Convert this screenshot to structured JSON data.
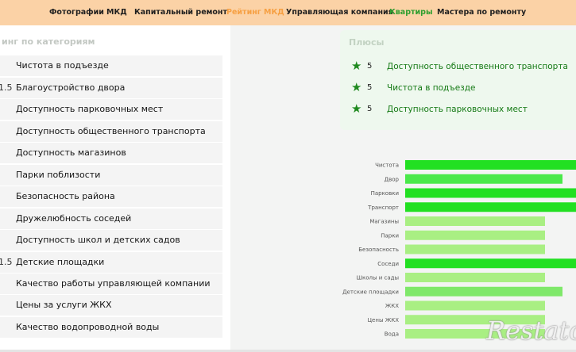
{
  "nav": {
    "items": [
      {
        "label": "Фотографии"
      },
      {
        "label": "МКД"
      },
      {
        "label": "Капитальный ремонт"
      },
      {
        "label": "Рейтинг МКД"
      },
      {
        "label": "Управляющая компания"
      },
      {
        "label": "Квартиры"
      },
      {
        "label": "Мастера по ремонту"
      }
    ],
    "active_item": "Рейтинг МКД",
    "highlight_item": "Квартиры"
  },
  "rating": {
    "title": "инг по категориям",
    "rows": [
      {
        "score": "",
        "label": "Чистота в подъезде"
      },
      {
        "score": "1.5",
        "label": "Благоустройство двора"
      },
      {
        "score": "",
        "label": "Доступность парковочных мест"
      },
      {
        "score": "",
        "label": "Доступность общественного транспорта"
      },
      {
        "score": "",
        "label": "Доступность магазинов"
      },
      {
        "score": "",
        "label": "Парки поблизости"
      },
      {
        "score": "",
        "label": "Безопасность района"
      },
      {
        "score": "",
        "label": "Дружелюбность соседей"
      },
      {
        "score": "",
        "label": "Доступность школ и детских садов"
      },
      {
        "score": "1.5",
        "label": "Детские площадки"
      },
      {
        "score": "",
        "label": "Качество работы управляющей компании"
      },
      {
        "score": "",
        "label": "Цены за услуги ЖКХ"
      },
      {
        "score": "",
        "label": "Качество водопроводной воды"
      }
    ]
  },
  "plus": {
    "title": "Плюсы",
    "items": [
      {
        "score": "5",
        "label": "Доступность общественного транспорта"
      },
      {
        "score": "5",
        "label": "Чистота в подъезде"
      },
      {
        "score": "5",
        "label": "Доступность парковочных мест"
      }
    ]
  },
  "chart_data": {
    "type": "bar",
    "orientation": "horizontal",
    "categories": [
      "Чистота",
      "Двор",
      "Парковки",
      "Транспорт",
      "Магазины",
      "Парки",
      "Безопасность",
      "Соседи",
      "Школы и сады",
      "Детские площадки",
      "ЖКХ",
      "Цены ЖКХ",
      "Вода"
    ],
    "values": [
      5,
      4.5,
      5,
      5,
      4,
      4,
      4,
      5,
      4,
      4.5,
      4,
      4,
      4
    ],
    "colors": [
      "#22e022",
      "#4ae94a",
      "#22e022",
      "#22e022",
      "#a9ef83",
      "#a9ef83",
      "#a9ef83",
      "#22e022",
      "#a9ef83",
      "#7fe86a",
      "#a9ef83",
      "#a9ef83",
      "#a9ef83"
    ],
    "xlim": [
      0,
      5
    ],
    "grid": false,
    "legend": "none"
  },
  "watermark": "Restato"
}
